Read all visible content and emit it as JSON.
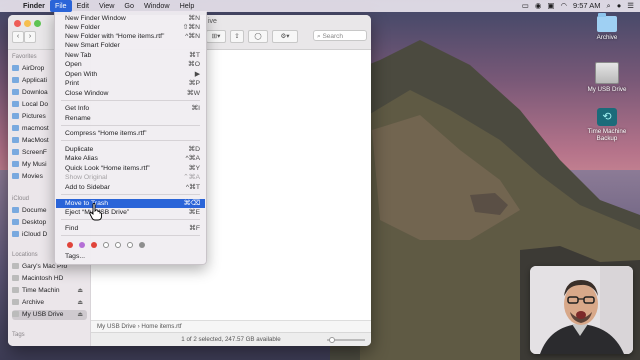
{
  "menubar": {
    "apple": "",
    "app": "Finder",
    "items": [
      "File",
      "Edit",
      "View",
      "Go",
      "Window",
      "Help"
    ],
    "clock": "9:57 AM",
    "status_icons": [
      "screen-mirror-icon",
      "record-icon",
      "camera-icon",
      "wifi-icon",
      "search-icon",
      "siri-icon",
      "list-icon"
    ]
  },
  "desktop": {
    "icons": [
      {
        "name": "Archive"
      },
      {
        "name": "My USB Drive"
      },
      {
        "name": "Time Machine Backup"
      }
    ]
  },
  "finder": {
    "title": "ive",
    "search_placeholder": "Search",
    "sidebar": {
      "favorites_heading": "Favorites",
      "favorites": [
        "AirDrop",
        "Applicati",
        "Downloa",
        "Local Do",
        "Pictures",
        "macmost",
        "MacMost",
        "ScreenF",
        "My Musi",
        "Movies"
      ],
      "icloud_heading": "iCloud",
      "icloud": [
        "Docume",
        "Desktop",
        "iCloud D"
      ],
      "locations_heading": "Locations",
      "locations": [
        "Gary's Mac Pro",
        "Macintosh HD",
        "Time Machin",
        "Archive",
        "My USB Drive"
      ],
      "tags_heading": "Tags"
    },
    "pathbar": {
      "drive": "My USB Drive",
      "separator": "›",
      "file": "Home items.rtf"
    },
    "status": "1 of 2 selected, 247.57 GB available"
  },
  "file_menu": {
    "items": [
      {
        "label": "New Finder Window",
        "shortcut": "⌘N"
      },
      {
        "label": "New Folder",
        "shortcut": "⇧⌘N"
      },
      {
        "label": "New Folder with “Home items.rtf”",
        "shortcut": "^⌘N"
      },
      {
        "label": "New Smart Folder",
        "shortcut": ""
      },
      {
        "label": "New Tab",
        "shortcut": "⌘T"
      },
      {
        "label": "Open",
        "shortcut": "⌘O"
      },
      {
        "label": "Open With",
        "shortcut": "▶"
      },
      {
        "label": "Print",
        "shortcut": "⌘P"
      },
      {
        "label": "Close Window",
        "shortcut": "⌘W"
      },
      {
        "label": "Get Info",
        "shortcut": "⌘I"
      },
      {
        "label": "Rename",
        "shortcut": ""
      },
      {
        "label": "Compress “Home items.rtf”",
        "shortcut": ""
      },
      {
        "label": "Duplicate",
        "shortcut": "⌘D"
      },
      {
        "label": "Make Alias",
        "shortcut": "^⌘A"
      },
      {
        "label": "Quick Look “Home items.rtf”",
        "shortcut": "⌘Y"
      },
      {
        "label": "Show Original",
        "shortcut": "⌃⌘A"
      },
      {
        "label": "Add to Sidebar",
        "shortcut": "^⌘T"
      },
      {
        "label": "Move to Trash",
        "shortcut": "⌘⌫"
      },
      {
        "label": "Eject “My USB Drive”",
        "shortcut": "⌘E"
      },
      {
        "label": "Find",
        "shortcut": "⌘F"
      },
      {
        "label": "Tags...",
        "shortcut": ""
      }
    ],
    "highlighted": "Move to Trash",
    "disabled": [
      "Show Original"
    ],
    "tag_colors": [
      "#e0443a",
      "#b46fd6",
      "#e0443a",
      "#ffffff",
      "#ffffff",
      "#ffffff",
      "#8e8e8e"
    ]
  },
  "colors": {
    "highlight": "#2a64d8"
  }
}
